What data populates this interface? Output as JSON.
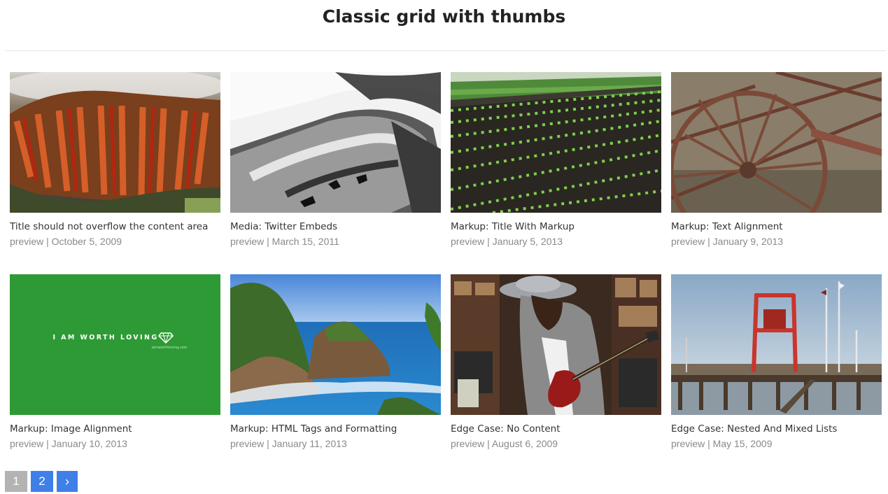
{
  "page": {
    "heading": "Classic grid with thumbs"
  },
  "posts": [
    {
      "title": "Title should not overflow the content area",
      "preview": "preview",
      "separator": "|",
      "date": "October 5, 2009",
      "image": "rusted-metal-closeup"
    },
    {
      "title": "Media: Twitter Embeds",
      "preview": "preview",
      "separator": "|",
      "date": "March 15, 2011",
      "image": "black-white-pipe"
    },
    {
      "title": "Markup: Title With Markup",
      "preview": "preview",
      "separator": "|",
      "date": "January 5, 2013",
      "image": "lettuce-field-rows"
    },
    {
      "title": "Markup: Text Alignment",
      "preview": "preview",
      "separator": "|",
      "date": "January 9, 2013",
      "image": "rusty-wagon-wheel"
    },
    {
      "title": "Markup: Image Alignment",
      "preview": "preview",
      "separator": "|",
      "date": "January 10, 2013",
      "image": "green-banner",
      "image_text": "I AM WORTH LOVING",
      "image_subtext": "iamworthloving.com"
    },
    {
      "title": "Markup: HTML Tags and Formatting",
      "preview": "preview",
      "separator": "|",
      "date": "January 11, 2013",
      "image": "coastal-rocks-ocean"
    },
    {
      "title": "Edge Case: No Content",
      "preview": "preview",
      "separator": "|",
      "date": "August 6, 2009",
      "image": "woman-with-guitar-record-store"
    },
    {
      "title": "Edge Case: Nested And Mixed Lists",
      "preview": "preview",
      "separator": "|",
      "date": "May 15, 2009",
      "image": "pier-with-red-tower"
    }
  ],
  "pagination": {
    "pages": [
      "1",
      "2"
    ],
    "current": "1",
    "next": "›"
  },
  "colors": {
    "link_blue": "#3f7fe8",
    "current_gray": "#b3b3b3",
    "banner_green": "#2e9a35",
    "meta_gray": "#8a8a8a"
  }
}
